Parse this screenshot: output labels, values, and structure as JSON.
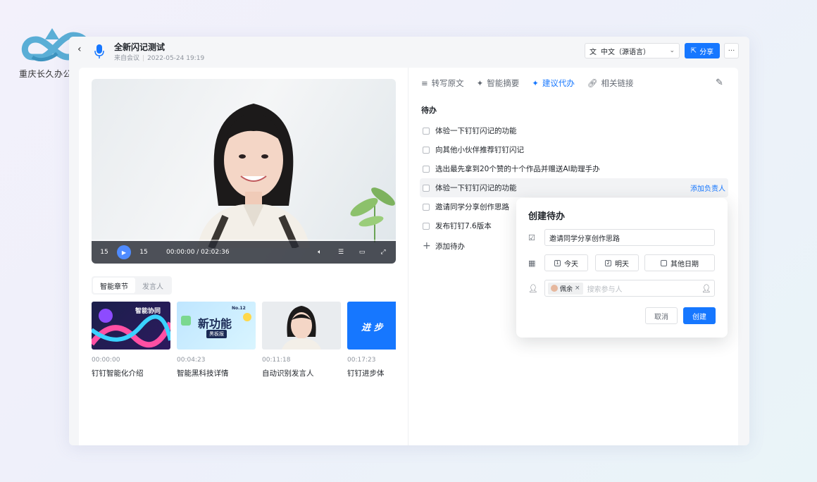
{
  "brand": {
    "name": "重庆长久办公服务"
  },
  "header": {
    "back_icon": "chevron-left-icon",
    "title": "全新闪记测试",
    "source": "来自会议",
    "date": "2022-05-24 19:19",
    "language": "中文（源语言）",
    "share_label": "分享",
    "more_label": "···"
  },
  "player": {
    "time": "00:00:00 / 02:02:36",
    "rewind_label": "15",
    "forward_label": "15"
  },
  "left_tabs": [
    {
      "label": "智能章节",
      "active": true
    },
    {
      "label": "发言人",
      "active": false
    }
  ],
  "chapters": [
    {
      "time": "00:00:00",
      "title": "钉钉智能化介绍",
      "thumb_text": "智能协同"
    },
    {
      "time": "00:04:23",
      "title": "智能黑科技详情",
      "thumb_text": "新功能",
      "thumb_sub": "黑板报",
      "thumb_badge": "No.12"
    },
    {
      "time": "00:11:18",
      "title": "自动识别发言人"
    },
    {
      "time": "00:17:23",
      "title": "钉钉进步体",
      "thumb_text": "进 步"
    }
  ],
  "right_tabs": [
    {
      "label": "转写原文",
      "active": false
    },
    {
      "label": "智能摘要",
      "active": false
    },
    {
      "label": "建议代办",
      "active": true
    },
    {
      "label": "相关链接",
      "active": false
    }
  ],
  "todo": {
    "heading": "待办",
    "items": [
      {
        "text": "体验一下钉钉闪记的功能"
      },
      {
        "text": "向其他小伙伴推荐钉钉闪记"
      },
      {
        "text": "选出最先拿到20个赞的十个作品并赠送AI助理手办"
      },
      {
        "text": "体验一下钉钉闪记的功能",
        "assign": "添加负责人"
      },
      {
        "text": "邀请同学分享创作思路"
      },
      {
        "text": "发布钉钉7.6版本"
      }
    ],
    "add_label": "添加待办"
  },
  "popup": {
    "title": "创建待办",
    "task_value": "邀请同学分享创作思路",
    "today": "今天",
    "tomorrow": "明天",
    "other_date": "其他日期",
    "participant": "佩余",
    "search_placeholder": "搜索参与人",
    "cancel": "取消",
    "create": "创建"
  },
  "colors": {
    "accent": "#1677ff",
    "logo": "#5aaed6"
  }
}
